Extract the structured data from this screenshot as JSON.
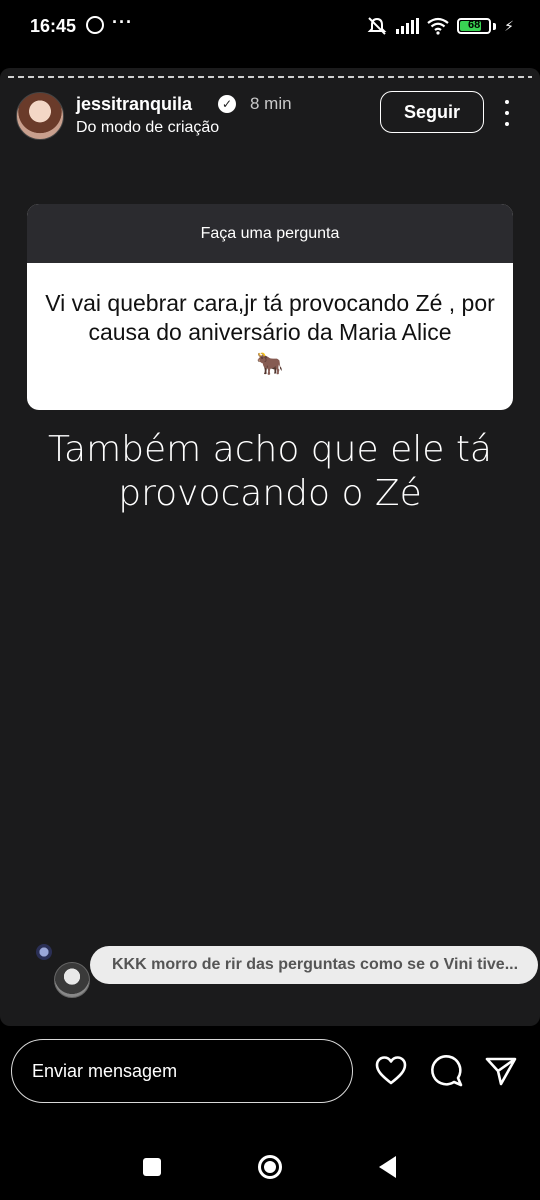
{
  "status_bar": {
    "time": "16:45",
    "battery": "68",
    "icons": [
      "whatsapp-icon",
      "more-dots-icon",
      "mute-icon",
      "signal-icon",
      "wifi-icon",
      "battery-icon",
      "charging-icon"
    ]
  },
  "story": {
    "username": "jessitranquila",
    "time_ago": "8 min",
    "subtitle": "Do modo de criação",
    "follow_label": "Seguir",
    "question_header": "Faça uma pergunta",
    "question_text": "Vi vai quebrar cara,jr tá provocando Zé , por causa do aniversário da Maria Alice",
    "question_emoji": "🐂",
    "answer_text": "Também acho que ele tá provocando o Zé",
    "reply_text": "KKK morro de rir das perguntas como se o Vini  tive..."
  },
  "footer": {
    "message_placeholder": "Enviar mensagem"
  },
  "colors": {
    "background": "#000000",
    "story_background": "#1b1b1c",
    "card_header": "#2b2b2f",
    "battery_green": "#39d353"
  }
}
